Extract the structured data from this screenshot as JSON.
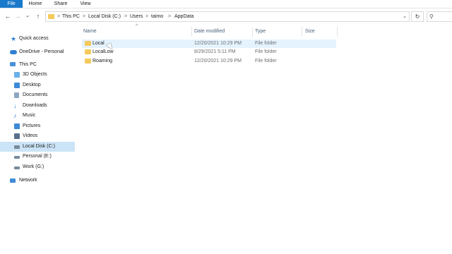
{
  "ribbon": {
    "tabs": [
      {
        "label": "File"
      },
      {
        "label": "Home"
      },
      {
        "label": "Share"
      },
      {
        "label": "View"
      }
    ]
  },
  "toolbar": {
    "back_icon": "arrow-left",
    "forward_icon": "arrow-right",
    "recent_icon": "chevron-down",
    "up_icon": "arrow-up",
    "refresh_icon": "refresh"
  },
  "address": {
    "crumbs": [
      "This PC",
      "Local Disk (C:)",
      "Users",
      "taimo",
      "AppData"
    ],
    "separator": ">"
  },
  "nav": {
    "items": [
      {
        "label": "Quick access",
        "icon": "star-icon",
        "color": "#2f7fd1"
      },
      {
        "label": "OneDrive - Personal",
        "icon": "cloud-icon",
        "color": "#2f7fd1"
      },
      {
        "label": "This PC",
        "icon": "computer-icon",
        "color": "#4a90d9"
      },
      {
        "label": "3D Objects",
        "icon": "cube-icon",
        "color": "#6ab0e8"
      },
      {
        "label": "Desktop",
        "icon": "desktop-icon",
        "color": "#3f8ad6"
      },
      {
        "label": "Documents",
        "icon": "document-icon",
        "color": "#6f8fb3"
      },
      {
        "label": "Downloads",
        "icon": "download-icon",
        "color": "#2f7fd1"
      },
      {
        "label": "Music",
        "icon": "music-icon",
        "color": "#2f7fd1"
      },
      {
        "label": "Pictures",
        "icon": "picture-icon",
        "color": "#3f8ad6"
      },
      {
        "label": "Videos",
        "icon": "video-icon",
        "color": "#5a6f8c"
      },
      {
        "label": "Local Disk (C:)",
        "icon": "drive-icon",
        "color": "#7a8a99"
      },
      {
        "label": "Personal (E:)",
        "icon": "drive-icon",
        "color": "#7a8a99"
      },
      {
        "label": "Work (G:)",
        "icon": "drive-icon",
        "color": "#7a8a99"
      },
      {
        "label": "Network",
        "icon": "network-icon",
        "color": "#3f8ad6"
      }
    ],
    "selected_index": 10
  },
  "columns": {
    "name": "Name",
    "date": "Date modified",
    "type": "Type",
    "size": "Size"
  },
  "files": [
    {
      "name": "Local",
      "date": "12/20/2021 10:29 PM",
      "type": "File folder",
      "size": ""
    },
    {
      "name": "LocalLow",
      "date": "8/29/2021 5:11 PM",
      "type": "File folder",
      "size": ""
    },
    {
      "name": "Roaming",
      "date": "12/20/2021 10:29 PM",
      "type": "File folder",
      "size": ""
    }
  ],
  "colors": {
    "accent": "#1979ca",
    "folder": "#f5c95c",
    "selection": "#cce4f7",
    "hover": "#e5f3ff"
  }
}
